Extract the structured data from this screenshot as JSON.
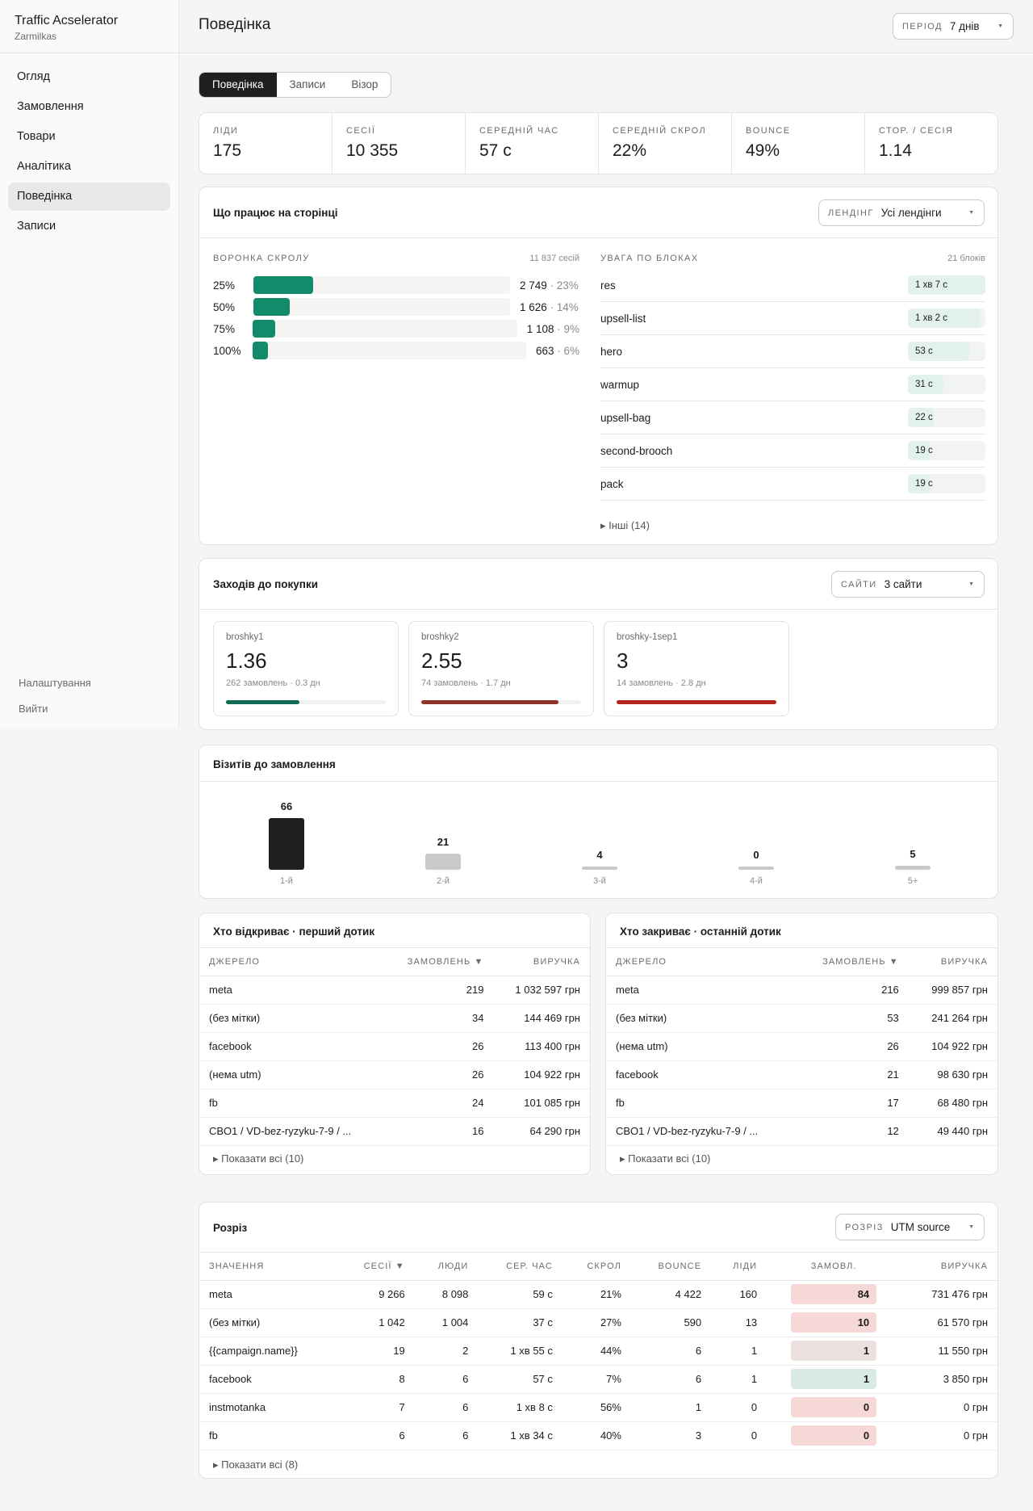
{
  "app": {
    "name": "Traffic Acselerator",
    "sub": "Zarmilkas"
  },
  "nav": [
    {
      "label": "Огляд"
    },
    {
      "label": "Замовлення"
    },
    {
      "label": "Товари"
    },
    {
      "label": "Аналітика"
    },
    {
      "label": "Поведінка"
    },
    {
      "label": "Записи"
    }
  ],
  "side_bottom": {
    "settings": "Налаштування",
    "logout": "Вийти"
  },
  "page": {
    "title": "Поведінка"
  },
  "period": {
    "label": "ПЕРІОД",
    "value": "7 днів"
  },
  "tabs": [
    {
      "label": "Поведінка"
    },
    {
      "label": "Записи"
    },
    {
      "label": "Візор"
    }
  ],
  "kpis": [
    {
      "label": "ЛІДИ",
      "value": "175"
    },
    {
      "label": "СЕСІЇ",
      "value": "10 355"
    },
    {
      "label": "СЕРЕДНІЙ ЧАС",
      "value": "57 с"
    },
    {
      "label": "СЕРЕДНІЙ СКРОЛ",
      "value": "22%"
    },
    {
      "label": "BOUNCE",
      "value": "49%"
    },
    {
      "label": "СТОР. / СЕСІЯ",
      "value": "1.14"
    }
  ],
  "works": {
    "title": "Що працює на сторінці",
    "landing": {
      "label": "ЛЕНДІНГ",
      "value": "Усі лендінги"
    },
    "funnel": {
      "title": "ВОРОНКА СКРОЛУ",
      "meta": "11 837 сесій",
      "rows": [
        {
          "pct": "25%",
          "count": "2 749",
          "share": "· 23%",
          "fill": 0.23
        },
        {
          "pct": "50%",
          "count": "1 626",
          "share": "· 14%",
          "fill": 0.14
        },
        {
          "pct": "75%",
          "count": "1 108",
          "share": "· 9%",
          "fill": 0.09
        },
        {
          "pct": "100%",
          "count": "663",
          "share": "· 6%",
          "fill": 0.06
        }
      ]
    },
    "blocks": {
      "title": "УВАГА ПО БЛОКАХ",
      "meta": "21 блоків",
      "rows": [
        {
          "name": "res",
          "value": "1 хв 7 с",
          "fill": 1.0
        },
        {
          "name": "upsell-list",
          "value": "1 хв 2 с",
          "fill": 0.93
        },
        {
          "name": "hero",
          "value": "53 с",
          "fill": 0.79
        },
        {
          "name": "warmup",
          "value": "31 с",
          "fill": 0.46
        },
        {
          "name": "upsell-bag",
          "value": "22 с",
          "fill": 0.33
        },
        {
          "name": "second-brooch",
          "value": "19 с",
          "fill": 0.28
        },
        {
          "name": "pack",
          "value": "19 с",
          "fill": 0.28
        }
      ],
      "more": "▸ Інші (14)"
    }
  },
  "entries": {
    "title": "Заходів до покупки",
    "sites": {
      "label": "САЙТИ",
      "value": "3 сайти"
    },
    "cards": [
      {
        "name": "broshky1",
        "value": "1.36",
        "sub": "262 замовлень · 0.3 дн",
        "fill": 0.46,
        "color": "#0f6b53"
      },
      {
        "name": "broshky2",
        "value": "2.55",
        "sub": "74 замовлень · 1.7 дн",
        "fill": 0.86,
        "color": "#8f3426"
      },
      {
        "name": "broshky-1sep1",
        "value": "3",
        "sub": "14 замовлень · 2.8 дн",
        "fill": 1.0,
        "color": "#b3261e"
      }
    ]
  },
  "visits": {
    "title": "Візитів до замовлення",
    "chart_data": {
      "type": "bar",
      "categories": [
        "1-й",
        "2-й",
        "3-й",
        "4-й",
        "5+"
      ],
      "values": [
        66,
        21,
        4,
        0,
        5
      ],
      "ylim": [
        0,
        66
      ],
      "colors": {
        "first": "#1f1f1f",
        "rest": "#c8c9ca"
      }
    }
  },
  "first_touch": {
    "title": "Хто відкриває · перший дотик",
    "headers": [
      "ДЖЕРЕЛО",
      "ЗАМОВЛЕНЬ ▼",
      "ВИРУЧКА"
    ],
    "rows": [
      [
        "meta",
        "219",
        "1 032 597 грн"
      ],
      [
        "(без мітки)",
        "34",
        "144 469 грн"
      ],
      [
        "facebook",
        "26",
        "113 400 грн"
      ],
      [
        "(нема utm)",
        "26",
        "104 922 грн"
      ],
      [
        "fb",
        "24",
        "101 085 грн"
      ],
      [
        "CBO1 / VD-bez-ryzyku-7-9 / ...",
        "16",
        "64 290 грн"
      ]
    ],
    "more": "▸ Показати всі (10)"
  },
  "last_touch": {
    "title": "Хто закриває · останній дотик",
    "headers": [
      "ДЖЕРЕЛО",
      "ЗАМОВЛЕНЬ ▼",
      "ВИРУЧКА"
    ],
    "rows": [
      [
        "meta",
        "216",
        "999 857 грн"
      ],
      [
        "(без мітки)",
        "53",
        "241 264 грн"
      ],
      [
        "(нема utm)",
        "26",
        "104 922 грн"
      ],
      [
        "facebook",
        "21",
        "98 630 грн"
      ],
      [
        "fb",
        "17",
        "68 480 грн"
      ],
      [
        "CBO1 / VD-bez-ryzyku-7-9 / ...",
        "12",
        "49 440 грн"
      ]
    ],
    "more": "▸ Показати всі (10)"
  },
  "breakdown": {
    "title": "Розріз",
    "select": {
      "label": "РОЗРІЗ",
      "value": "UTM source"
    },
    "headers": [
      "ЗНАЧЕННЯ",
      "СЕСІЇ ▼",
      "ЛЮДИ",
      "СЕР. ЧАС",
      "СКРОЛ",
      "BOUNCE",
      "ЛІДИ",
      "ЗАМОВЛ.",
      "ВИРУЧКА"
    ],
    "rows": [
      [
        "meta",
        "9 266",
        "8 098",
        "59 с",
        "21%",
        "4 422",
        "160",
        "84",
        "731 476 грн"
      ],
      [
        "(без мітки)",
        "1 042",
        "1 004",
        "37 с",
        "27%",
        "590",
        "13",
        "10",
        "61 570 грн"
      ],
      [
        "{{campaign.name}}",
        "19",
        "2",
        "1 хв 55 с",
        "44%",
        "6",
        "1",
        "1",
        "11 550 грн"
      ],
      [
        "facebook",
        "8",
        "6",
        "57 с",
        "7%",
        "6",
        "1",
        "1",
        "3 850 грн"
      ],
      [
        "instmotanka",
        "7",
        "6",
        "1 хв 8 с",
        "56%",
        "1",
        "0",
        "0",
        "0 грн"
      ],
      [
        "fb",
        "6",
        "6",
        "1 хв 34 с",
        "40%",
        "3",
        "0",
        "0",
        "0 грн"
      ]
    ],
    "order_colors": [
      "#f6d9d7",
      "#f6d9d7",
      "#ece0de",
      "#d9e9e4",
      "#f6d9d7",
      "#f6d9d7"
    ],
    "more": "▸ Показати всі (8)"
  }
}
